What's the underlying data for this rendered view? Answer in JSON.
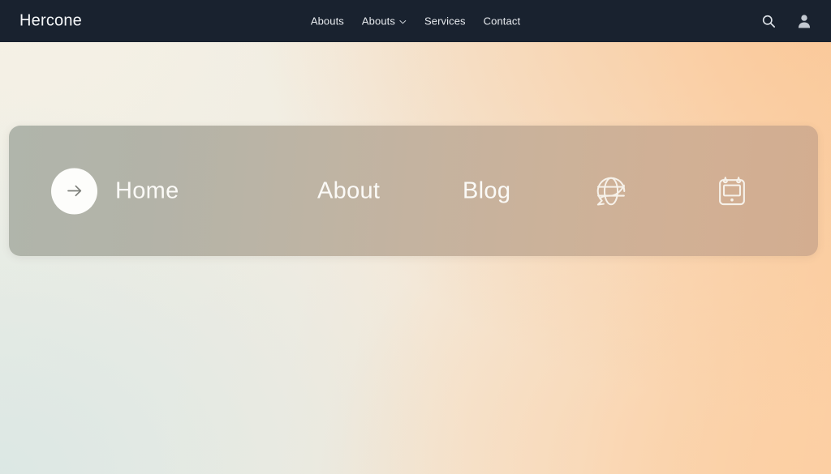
{
  "header": {
    "brand": "Hercone",
    "background_color": "#19222f",
    "text_color": "#e7eaee",
    "nav_items": [
      {
        "label": "Abouts",
        "has_dropdown": false
      },
      {
        "label": "Abouts",
        "has_dropdown": true,
        "caret_icon": "chevron-down-icon"
      },
      {
        "label": "Services",
        "has_dropdown": false
      },
      {
        "label": "Contact",
        "has_dropdown": false
      }
    ],
    "actions": [
      {
        "icon": "search-icon",
        "label": "Search"
      },
      {
        "icon": "user-icon",
        "label": "Account"
      }
    ]
  },
  "hero": {
    "card_gradient_from": "#b0b5ab",
    "card_gradient_to": "#d3ad90",
    "card_radius_px": 14,
    "items": [
      {
        "type": "link-with-arrow",
        "label": "Home",
        "arrow_icon": "arrow-right-icon",
        "circle_color": "#fdfdfb"
      },
      {
        "type": "link",
        "label": "About"
      },
      {
        "type": "link",
        "label": "Blog"
      },
      {
        "type": "icon",
        "label": "",
        "icon": "globe-icon"
      },
      {
        "type": "icon",
        "label": "",
        "icon": "calendar-icon"
      }
    ],
    "label_color": "#fbfaf7"
  },
  "background": {
    "left_color": "#e3ece8",
    "center_color": "#f1ece1",
    "right_color": "#fbcfa4"
  }
}
